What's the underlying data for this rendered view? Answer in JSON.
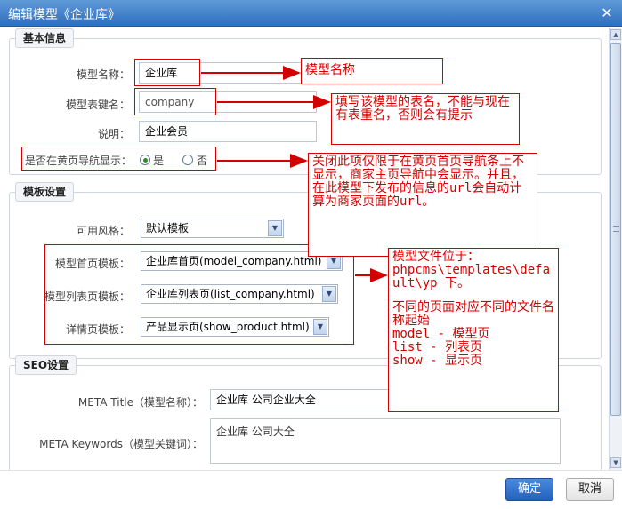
{
  "window": {
    "title": "编辑模型《企业库》",
    "close_glyph": "✕"
  },
  "basic_info": {
    "legend": "基本信息",
    "model_name_label": "模型名称：",
    "model_name_value": "企业库",
    "table_key_label": "模型表键名：",
    "table_key_value": "company",
    "desc_label": "说明：",
    "desc_value": "企业会员",
    "nav_label": "是否在黄页导航显示：",
    "nav_yes": "是",
    "nav_no": "否",
    "nav_selected": "yes"
  },
  "template_settings": {
    "legend": "模板设置",
    "style_label": "可用风格：",
    "style_value": "默认模板",
    "home_tpl_label": "模型首页模板：",
    "home_tpl_value": "企业库首页(model_company.html)",
    "list_tpl_label": "模型列表页模板：",
    "list_tpl_value": "企业库列表页(list_company.html)",
    "detail_tpl_label": "详情页模板：",
    "detail_tpl_value": "产品显示页(show_product.html)"
  },
  "seo": {
    "legend": "SEO设置",
    "meta_title_label": "META Title（模型名称）：",
    "meta_title_value": "企业库 公司企业大全",
    "meta_keywords_label": "META Keywords（模型关键词）：",
    "meta_keywords_value": "企业库 公司大全"
  },
  "annotations": {
    "note1": "模型名称",
    "note2": "填写该模型的表名，不能与现在有表重名，否则会有提示",
    "note3": "关闭此项仅限于在黄页首页导航条上不显示，商家主页导航中会显示。并且，在此模型下发布的信息的url会自动计算为商家页面的url。",
    "note4_line1": "模型文件位于：",
    "note4_line2": "phpcms\\templates\\default\\yp 下。",
    "note4_line3": "不同的页面对应不同的文件名称起始",
    "note4_line4": "model - 模型页",
    "note4_line5": "list - 列表页",
    "note4_line6": "show - 显示页"
  },
  "footer": {
    "ok_label": "确定",
    "cancel_label": "取消"
  },
  "colors": {
    "annotation_red": "#d40000",
    "title_bar": "#2f6fbe",
    "ok_button": "#2361bb"
  }
}
